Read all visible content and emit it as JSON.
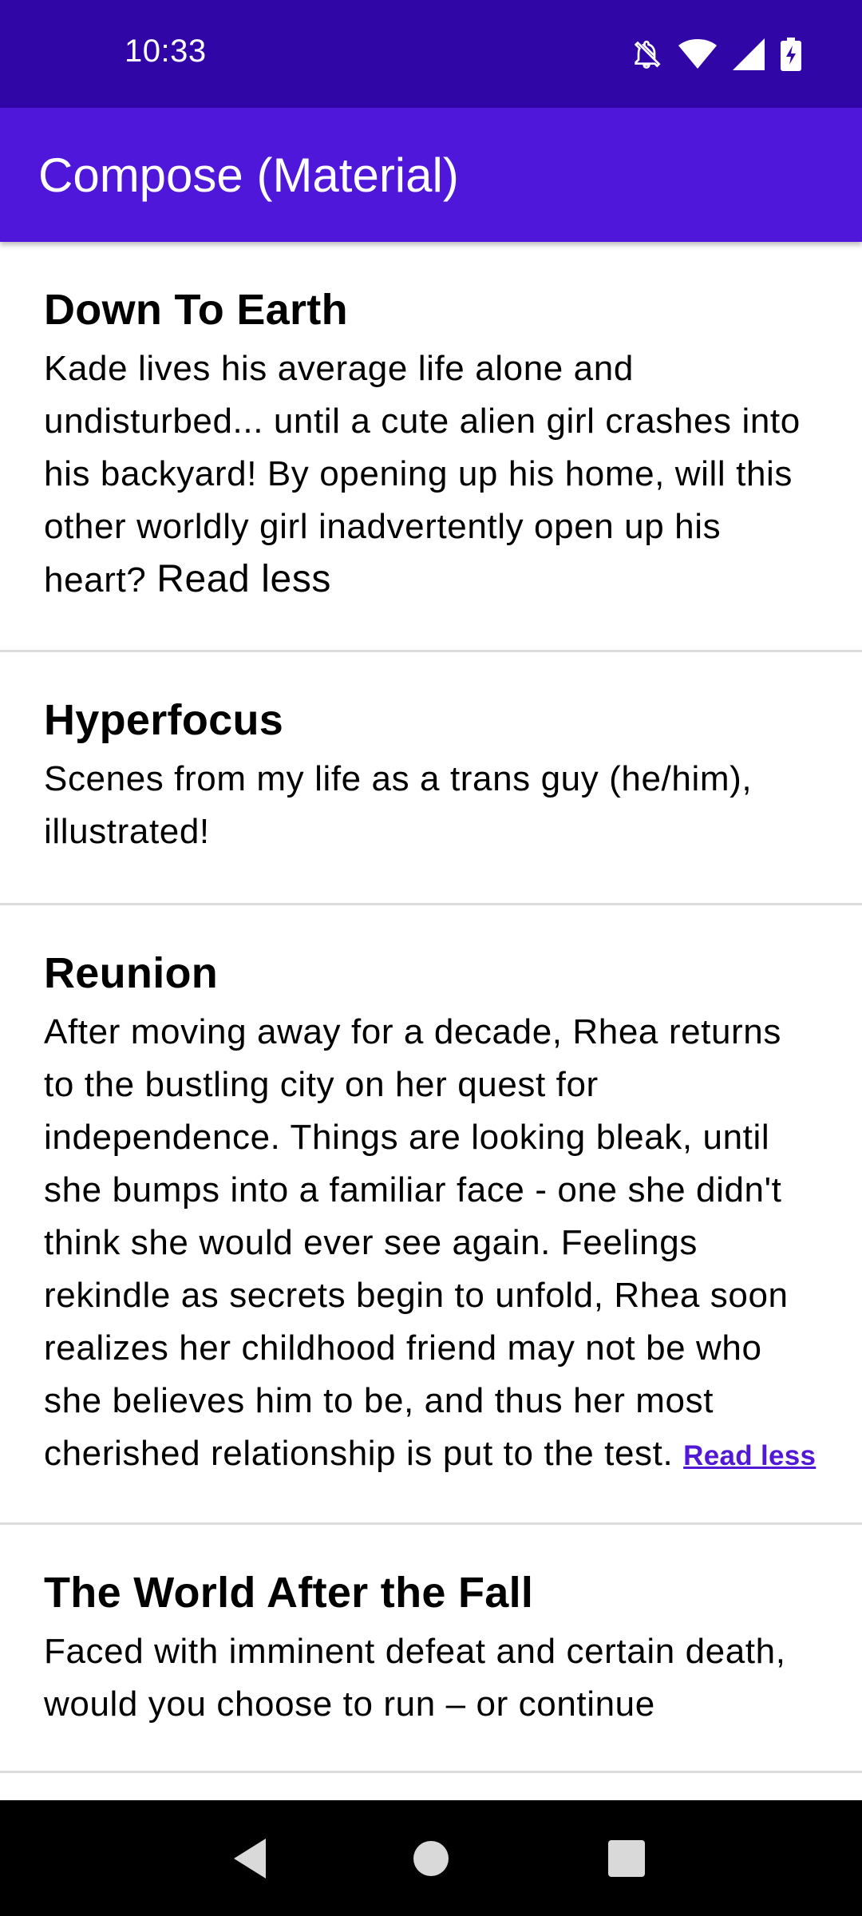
{
  "status_bar": {
    "time": "10:33",
    "icons": [
      "notifications-off-icon",
      "wifi-icon",
      "cell-signal-icon",
      "battery-charging-icon"
    ]
  },
  "app_bar": {
    "title": "Compose (Material)"
  },
  "items": [
    {
      "title": "Down To Earth",
      "description": "Kade lives his average life alone and undisturbed... until a cute alien girl crashes into his backyard! By opening up his home, will this other worldly girl inadvertently open up his heart? ",
      "read_less": "Read less"
    },
    {
      "title": "Hyperfocus",
      "description": "Scenes from my life as a trans guy (he/him), illustrated!"
    },
    {
      "title": "Reunion",
      "description": "After moving away for a decade, Rhea returns to the bustling city on her quest for independence. Things are looking bleak, until she bumps into a familiar face - one she didn't think she would ever see again. Feelings rekindle as secrets begin to unfold, Rhea soon realizes her childhood friend may not be who she believes him to be, and thus her most cherished relationship is put to the test. ",
      "read_less": "Read less"
    },
    {
      "title": "The World After the Fall",
      "description": "Faced with imminent defeat and certain death, would you choose to run – or continue"
    }
  ],
  "nav_bar": {
    "buttons": [
      "back-icon",
      "home-icon",
      "recents-icon"
    ]
  },
  "colors": {
    "status_bar": "#3007A6",
    "app_bar": "#4F17DA",
    "link": "#5118D6",
    "divider": "#dcdcdc"
  }
}
